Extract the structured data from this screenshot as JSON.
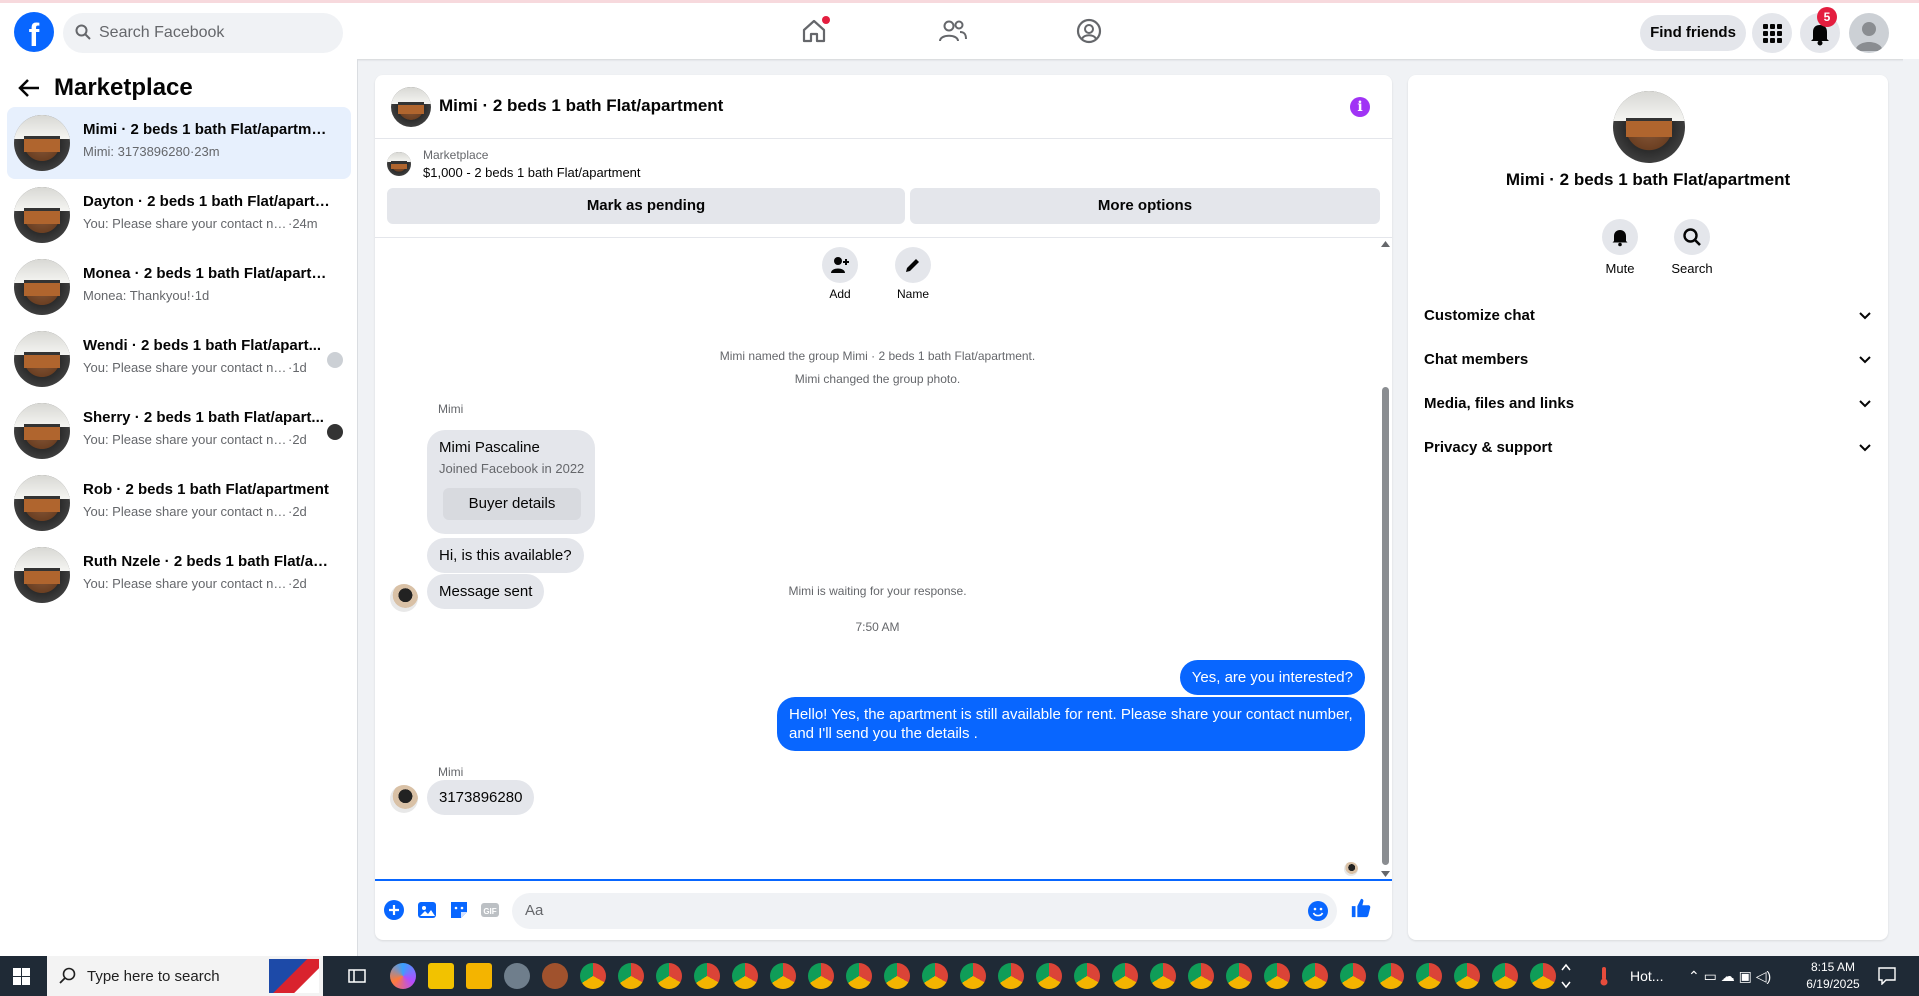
{
  "topbar": {
    "search_placeholder": "Search Facebook",
    "find_friends": "Find friends",
    "notification_count": "5"
  },
  "sidebar": {
    "title": "Marketplace",
    "conversations": [
      {
        "name": "Mimi · 2 beds 1 bath Flat/apartment",
        "snippet": "Mimi: 3173896280",
        "time": "·23m",
        "active": true
      },
      {
        "name": "Dayton · 2 beds 1 bath Flat/apartm...",
        "snippet": "You: Please share your contact num...",
        "time": "·24m"
      },
      {
        "name": "Monea · 2 beds 1 bath Flat/apartm...",
        "snippet": "Monea: Thankyou!",
        "time": "·1d"
      },
      {
        "name": "Wendi · 2 beds 1 bath Flat/apart...",
        "snippet": "You: Please share your contact nu...",
        "time": "·1d"
      },
      {
        "name": "Sherry · 2 beds 1 bath Flat/apart...",
        "snippet": "You: Please share your contact nu...",
        "time": "·2d"
      },
      {
        "name": "Rob · 2 beds 1 bath Flat/apartment",
        "snippet": "You: Please share your contact numbe...",
        "time": "·2d"
      },
      {
        "name": "Ruth Nzele · 2 beds 1 bath Flat/ap...",
        "snippet": "You: Please share your contact numbe...",
        "time": "·2d"
      }
    ]
  },
  "chat": {
    "title": "Mimi · 2 beds 1 bath Flat/apartment",
    "listing_category": "Marketplace",
    "listing_price": "$1,000 - 2 beds 1 bath Flat/apartment",
    "mark_pending": "Mark as pending",
    "more_options": "More options",
    "action_add": "Add",
    "action_name": "Name",
    "sys_named": "Mimi named the group Mimi · 2 beds 1 bath Flat/apartment.",
    "sys_photo": "Mimi changed the group photo.",
    "sender_1": "Mimi",
    "card_name": "Mimi Pascaline",
    "card_joined": "Joined Facebook in 2022",
    "card_button": "Buyer details",
    "msg_available": "Hi, is this available?",
    "msg_sent": "Message sent",
    "sys_waiting": "Mimi is waiting for your response.",
    "timestamp": "7:50 AM",
    "out_1": "Yes, are you interested?",
    "out_2_line1": "Hello! Yes, the apartment is still available for rent. Please share your contact number,",
    "out_2_line2": "and I'll send you the details .",
    "sender_2": "Mimi",
    "msg_number": "3173896280",
    "composer_placeholder": "Aa"
  },
  "details": {
    "title": "Mimi · 2 beds 1 bath Flat/apartment",
    "mute": "Mute",
    "search": "Search",
    "sections": [
      "Customize chat",
      "Chat members",
      "Media, files and links",
      "Privacy & support"
    ]
  },
  "taskbar": {
    "search_placeholder": "Type here to search",
    "weather": "Hot...",
    "time": "8:15 AM",
    "date": "6/19/2025"
  },
  "colors": {
    "brand": "#0866ff",
    "outgoing_bubble": "#0866ff",
    "info_icon": "#a033f5",
    "badge": "#e41e3f"
  }
}
